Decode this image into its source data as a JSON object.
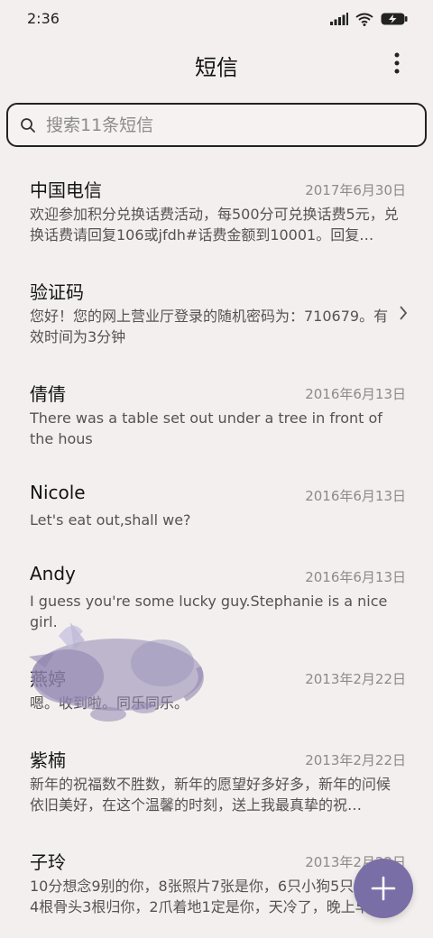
{
  "status_bar": {
    "time": "2:36"
  },
  "header": {
    "title": "短信",
    "menu_icon": "more-vertical-icon"
  },
  "search": {
    "placeholder": "搜索11条短信",
    "value": ""
  },
  "conversations": [
    {
      "name": "中国电信",
      "date": "2017年6月30日",
      "preview": "欢迎参加积分兑换话费活动，每500分可兑换话费5元，兑换话费请回复106或jfdh#话费金额到10001。回复…"
    },
    {
      "name": "验证码",
      "date": "",
      "preview": "您好！您的网上营业厅登录的随机密码为：710679。有效时间为3分钟"
    },
    {
      "name": "倩倩",
      "date": "2016年6月13日",
      "preview": "There was a table set out under a tree in front of the hous"
    },
    {
      "name": "Nicole",
      "date": "2016年6月13日",
      "preview": "Let's eat out,shall we?"
    },
    {
      "name": "Andy",
      "date": "2016年6月13日",
      "preview": "I guess you're some lucky guy.Stephanie is a nice girl."
    },
    {
      "name": "燕婷",
      "date": "2013年2月22日",
      "preview": "嗯。收到啦。同乐同乐。"
    },
    {
      "name": "紫楠",
      "date": "2013年2月22日",
      "preview": "新年的祝福数不胜数，新年的愿望好多好多，新年的问候依旧美好，在这个温馨的时刻，送上我最真挚的祝…"
    },
    {
      "name": "子玲",
      "date": "2013年2月22日",
      "preview": "10分想念9别的你，8张照片7张是你，6只小狗5只是你，4根骨头3根归你，2爪着地1定是你，天冷了，晚上早点…"
    }
  ],
  "colors": {
    "background": "#f3efee",
    "fab": "#7a6ea6",
    "sticker": "#8f86b0"
  },
  "fab": {
    "icon": "plus-icon"
  }
}
